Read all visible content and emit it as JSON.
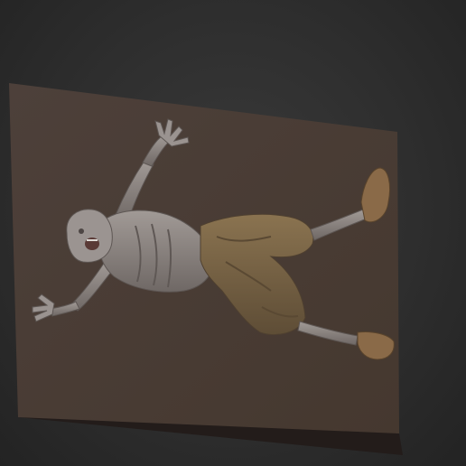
{
  "scene": {
    "subject": "sculpted-zombie-figure-on-relief-plaque",
    "colors": {
      "background": "#2e2e2e",
      "plaque_top": "#4a3d38",
      "plaque_edge": "#2a221f",
      "skin": "#8e8784",
      "skin_shadow": "#5d5653",
      "pants": "#7b6646",
      "pants_shadow": "#4f4030",
      "boots": "#8a6a48"
    }
  }
}
